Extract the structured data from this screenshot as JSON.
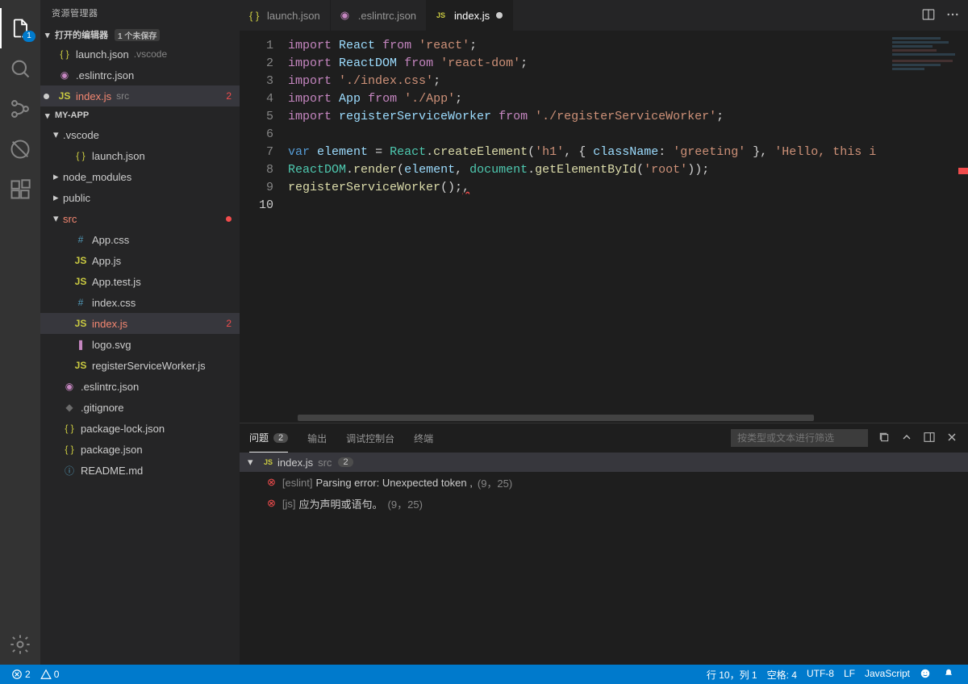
{
  "sidebar": {
    "title": "资源管理器",
    "openEditorsHeader": "打开的编辑器",
    "openEditorsBadge": "1 个未保存",
    "projectName": "MY-APP",
    "openEditors": [
      {
        "name": "launch.json",
        "path": ".vscode",
        "iconClass": "ic-json",
        "iconGlyph": "{ }"
      },
      {
        "name": ".eslintrc.json",
        "path": "",
        "iconClass": "ic-eslint",
        "iconGlyph": "◉"
      },
      {
        "name": "index.js",
        "path": "src",
        "iconClass": "ic-js",
        "iconGlyph": "JS",
        "active": true,
        "error": "2",
        "modified": true
      }
    ],
    "tree": [
      {
        "name": ".vscode",
        "type": "folder",
        "depth": 1,
        "expanded": true
      },
      {
        "name": "launch.json",
        "type": "file",
        "depth": 2,
        "iconClass": "ic-json",
        "iconGlyph": "{ }"
      },
      {
        "name": "node_modules",
        "type": "folder",
        "depth": 1,
        "expanded": false
      },
      {
        "name": "public",
        "type": "folder",
        "depth": 1,
        "expanded": false
      },
      {
        "name": "src",
        "type": "folder",
        "depth": 1,
        "expanded": true,
        "errorDot": true,
        "errClass": true
      },
      {
        "name": "App.css",
        "type": "file",
        "depth": 2,
        "iconClass": "ic-css",
        "iconGlyph": "#"
      },
      {
        "name": "App.js",
        "type": "file",
        "depth": 2,
        "iconClass": "ic-js",
        "iconGlyph": "JS"
      },
      {
        "name": "App.test.js",
        "type": "file",
        "depth": 2,
        "iconClass": "ic-js",
        "iconGlyph": "JS"
      },
      {
        "name": "index.css",
        "type": "file",
        "depth": 2,
        "iconClass": "ic-css",
        "iconGlyph": "#"
      },
      {
        "name": "index.js",
        "type": "file",
        "depth": 2,
        "iconClass": "ic-js",
        "iconGlyph": "JS",
        "active": true,
        "error": "2",
        "errClass": true
      },
      {
        "name": "logo.svg",
        "type": "file",
        "depth": 2,
        "iconClass": "ic-svg",
        "iconGlyph": "❚"
      },
      {
        "name": "registerServiceWorker.js",
        "type": "file",
        "depth": 2,
        "iconClass": "ic-js",
        "iconGlyph": "JS"
      },
      {
        "name": ".eslintrc.json",
        "type": "file",
        "depth": 1,
        "iconClass": "ic-eslint",
        "iconGlyph": "◉"
      },
      {
        "name": ".gitignore",
        "type": "file",
        "depth": 1,
        "iconClass": "ic-git",
        "iconGlyph": "◆"
      },
      {
        "name": "package-lock.json",
        "type": "file",
        "depth": 1,
        "iconClass": "ic-json",
        "iconGlyph": "{ }"
      },
      {
        "name": "package.json",
        "type": "file",
        "depth": 1,
        "iconClass": "ic-json",
        "iconGlyph": "{ }"
      },
      {
        "name": "README.md",
        "type": "file",
        "depth": 1,
        "iconClass": "ic-md",
        "iconGlyph": "ⓘ"
      }
    ]
  },
  "tabs": [
    {
      "name": "launch.json",
      "iconClass": "ic-json",
      "iconGlyph": "{ }",
      "active": false
    },
    {
      "name": ".eslintrc.json",
      "iconClass": "ic-eslint",
      "iconGlyph": "◉",
      "active": false
    },
    {
      "name": "index.js",
      "iconClass": "ic-js",
      "iconGlyph": "JS",
      "active": true,
      "modified": true
    }
  ],
  "editor": {
    "lineCount": 10,
    "activeLine": 10,
    "codeHtml": "<span class='tok-kw'>import</span> <span class='tok-id'>React</span> <span class='tok-kw'>from</span> <span class='tok-str'>'react'</span><span class='tok-pl'>;</span>\n<span class='tok-kw'>import</span> <span class='tok-id'>ReactDOM</span> <span class='tok-kw'>from</span> <span class='tok-str'>'react-dom'</span><span class='tok-pl'>;</span>\n<span class='tok-kw'>import</span> <span class='tok-str'>'./index.css'</span><span class='tok-pl'>;</span>\n<span class='tok-kw'>import</span> <span class='tok-id'>App</span> <span class='tok-kw'>from</span> <span class='tok-str'>'./App'</span><span class='tok-pl'>;</span>\n<span class='tok-kw'>import</span> <span class='tok-id'>registerServiceWorker</span> <span class='tok-kw'>from</span> <span class='tok-str'>'./registerServiceWorker'</span><span class='tok-pl'>;</span>\n\n<span class='tok-var'>var</span> <span class='tok-id'>element</span> <span class='tok-pl'>=</span> <span class='tok-type'>React</span><span class='tok-pl'>.</span><span class='tok-fn'>createElement</span><span class='tok-pl'>(</span><span class='tok-str'>'h1'</span><span class='tok-pl'>, { </span><span class='tok-prop'>className</span><span class='tok-pl'>: </span><span class='tok-str'>'greeting'</span> <span class='tok-pl'>}, </span><span class='tok-str'>'Hello, this i</span>\n<span class='tok-type'>ReactDOM</span><span class='tok-pl'>.</span><span class='tok-fn'>render</span><span class='tok-pl'>(</span><span class='tok-id'>element</span><span class='tok-pl'>, </span><span class='tok-type'>document</span><span class='tok-pl'>.</span><span class='tok-fn'>getElementById</span><span class='tok-pl'>(</span><span class='tok-str'>'root'</span><span class='tok-pl'>));</span>\n<span class='tok-fn'>registerServiceWorker</span><span class='tok-pl'>();</span><span style='text-decoration: wavy underline #f14c4c'>,</span>\n"
  },
  "panel": {
    "tabs": {
      "problems": "问题",
      "problemsCount": "2",
      "output": "输出",
      "debugConsole": "调试控制台",
      "terminal": "终端"
    },
    "filterPlaceholder": "按类型或文本进行筛选",
    "fileHeader": {
      "name": "index.js",
      "path": "src",
      "count": "2"
    },
    "problems": [
      {
        "source": "[eslint]",
        "message": "Parsing error: Unexpected token ,",
        "pos": "(9，25)"
      },
      {
        "source": "[js]",
        "message": "应为声明或语句。",
        "pos": "(9，25)"
      }
    ]
  },
  "statusbar": {
    "errors": "2",
    "warnings": "0",
    "lineCol": "行 10，列 1",
    "spaces": "空格: 4",
    "encoding": "UTF-8",
    "eol": "LF",
    "language": "JavaScript"
  },
  "activityBadge": "1"
}
